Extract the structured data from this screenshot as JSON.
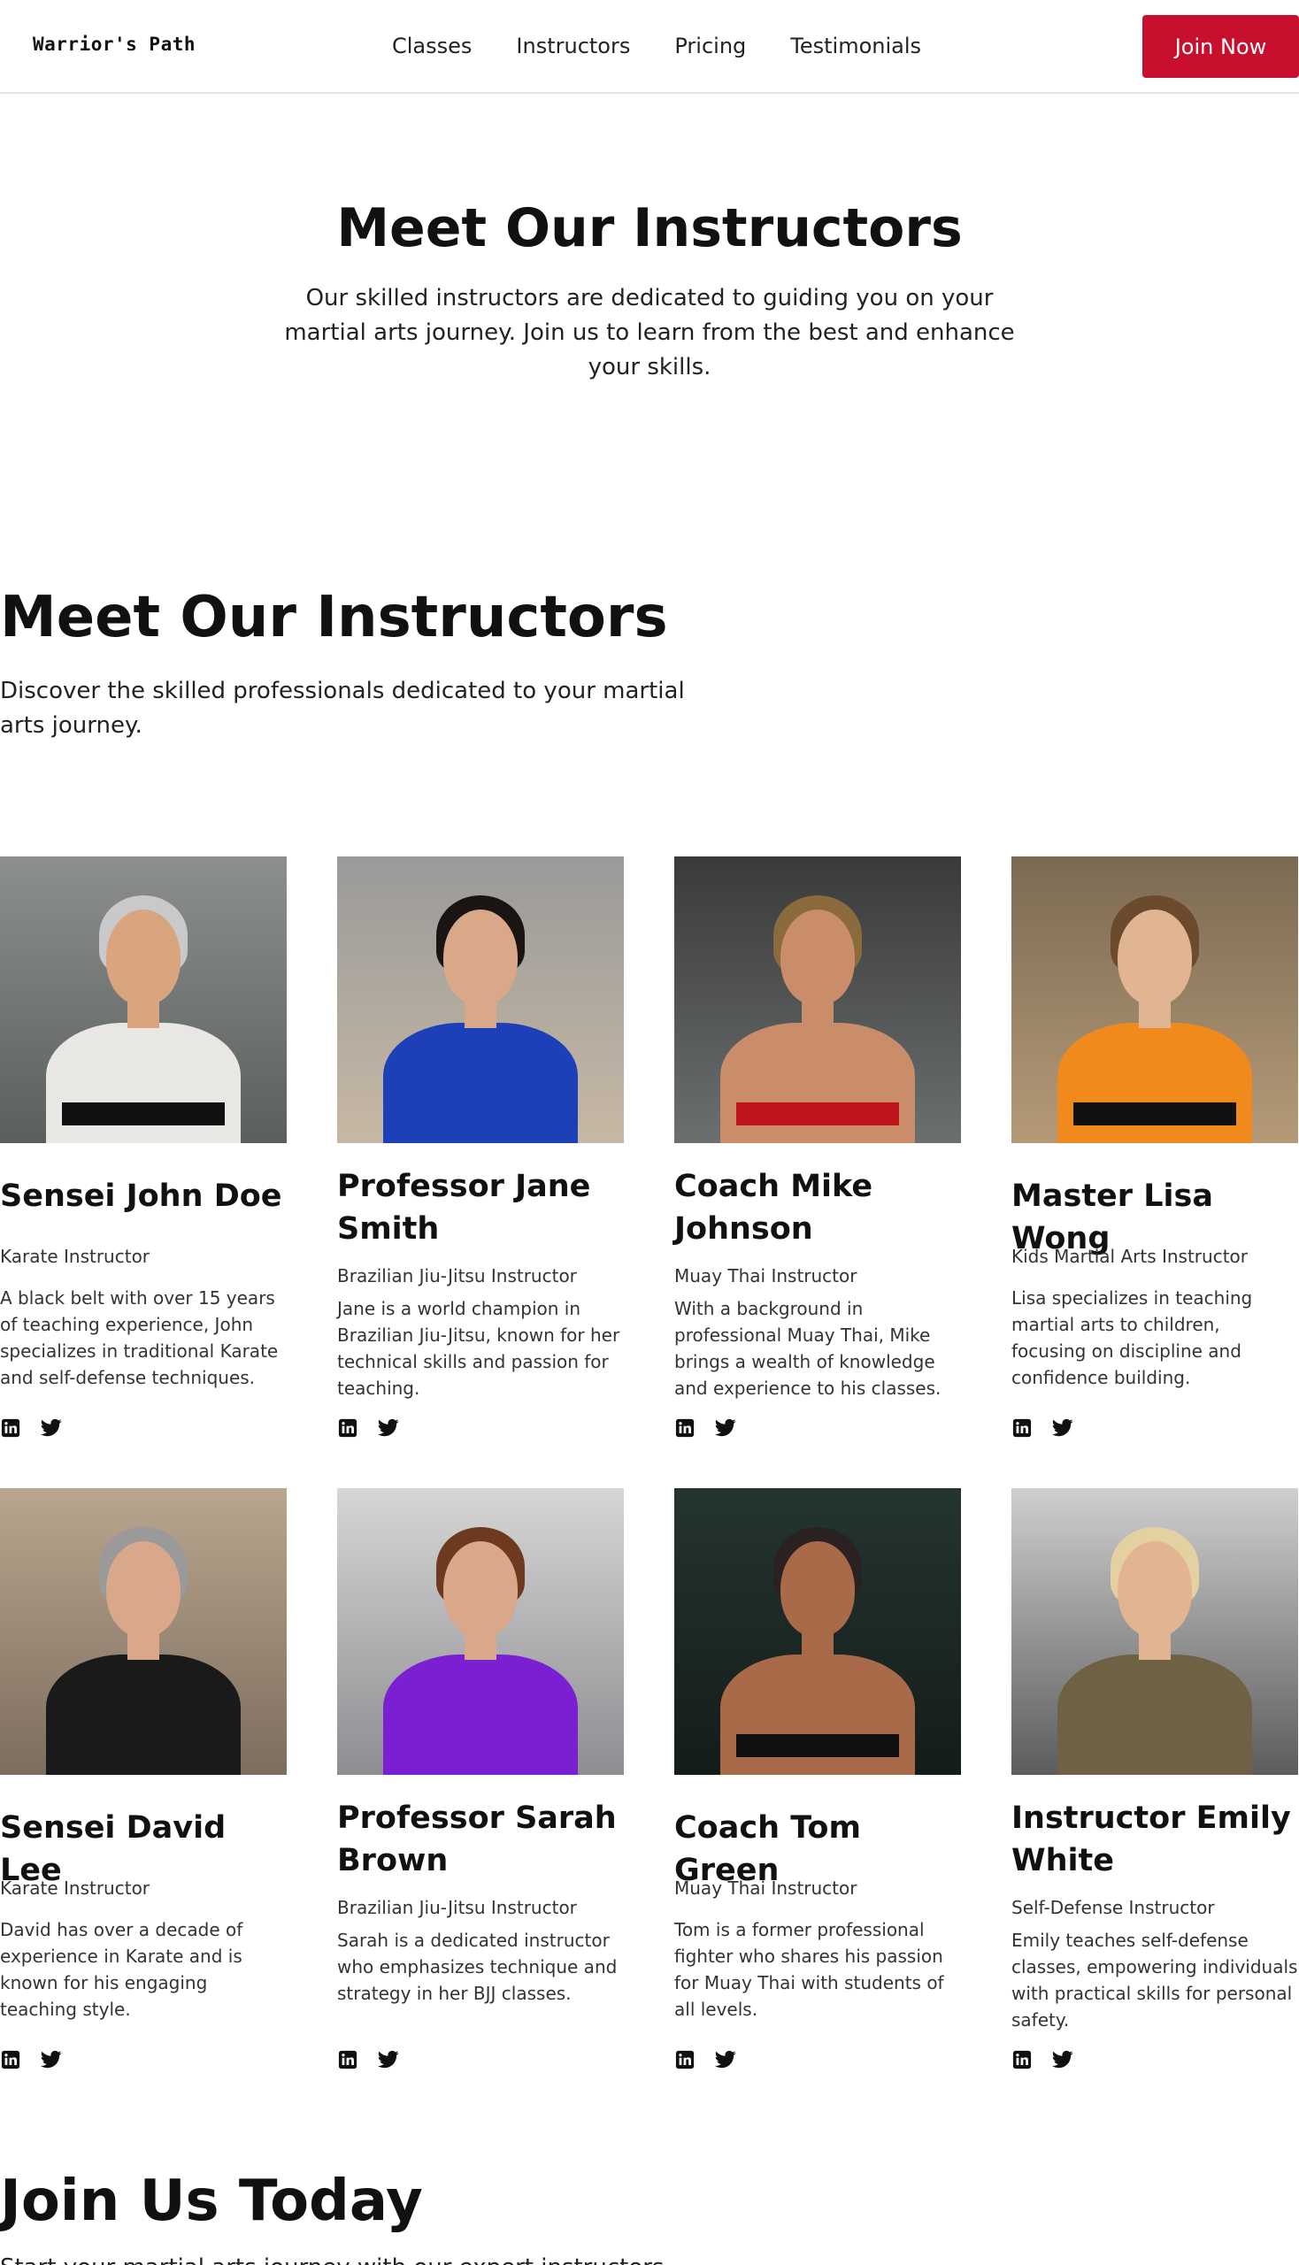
{
  "header": {
    "logo": "Warrior's Path",
    "nav": [
      "Classes",
      "Instructors",
      "Pricing",
      "Testimonials"
    ],
    "cta": "Join Now"
  },
  "hero": {
    "title": "Meet Our Instructors",
    "subtitle": "Our skilled instructors are dedicated to guiding you on your martial arts journey. Join us to learn from the best and enhance your skills."
  },
  "section": {
    "title": "Meet Our Instructors",
    "subtitle": "Discover the skilled professionals dedicated to your martial arts journey."
  },
  "instructors": [
    {
      "name": "Sensei John Doe",
      "role": "Karate Instructor",
      "bio": "A black belt with over 15 years of teaching experience, John specializes in traditional Karate and self-defense techniques."
    },
    {
      "name": "Professor Jane Smith",
      "role": "Brazilian Jiu-Jitsu Instructor",
      "bio": "Jane is a world champion in Brazilian Jiu-Jitsu, known for her technical skills and passion for teaching."
    },
    {
      "name": "Coach Mike Johnson",
      "role": "Muay Thai Instructor",
      "bio": "With a background in professional Muay Thai, Mike brings a wealth of knowledge and experience to his classes."
    },
    {
      "name": "Master Lisa Wong",
      "role": "Kids Martial Arts Instructor",
      "bio": "Lisa specializes in teaching martial arts to children, focusing on discipline and confidence building."
    },
    {
      "name": "Sensei David Lee",
      "role": "Karate Instructor",
      "bio": "David has over a decade of experience in Karate and is known for his engaging teaching style."
    },
    {
      "name": "Professor Sarah Brown",
      "role": "Brazilian Jiu-Jitsu Instructor",
      "bio": "Sarah is a dedicated instructor who emphasizes technique and strategy in her BJJ classes."
    },
    {
      "name": "Coach Tom Green",
      "role": "Muay Thai Instructor",
      "bio": "Tom is a former professional fighter who shares his passion for Muay Thai with students of all levels."
    },
    {
      "name": "Instructor Emily White",
      "role": "Self-Defense Instructor",
      "bio": "Emily teaches self-defense classes, empowering individuals with practical skills for personal safety."
    }
  ],
  "social_icons": [
    "linkedin-icon",
    "twitter-icon"
  ],
  "cta_section": {
    "title": "Join Us Today",
    "subtitle": "Start your martial arts journey with our expert instructors"
  },
  "colors": {
    "accent": "#c8102e",
    "text": "#111111"
  }
}
